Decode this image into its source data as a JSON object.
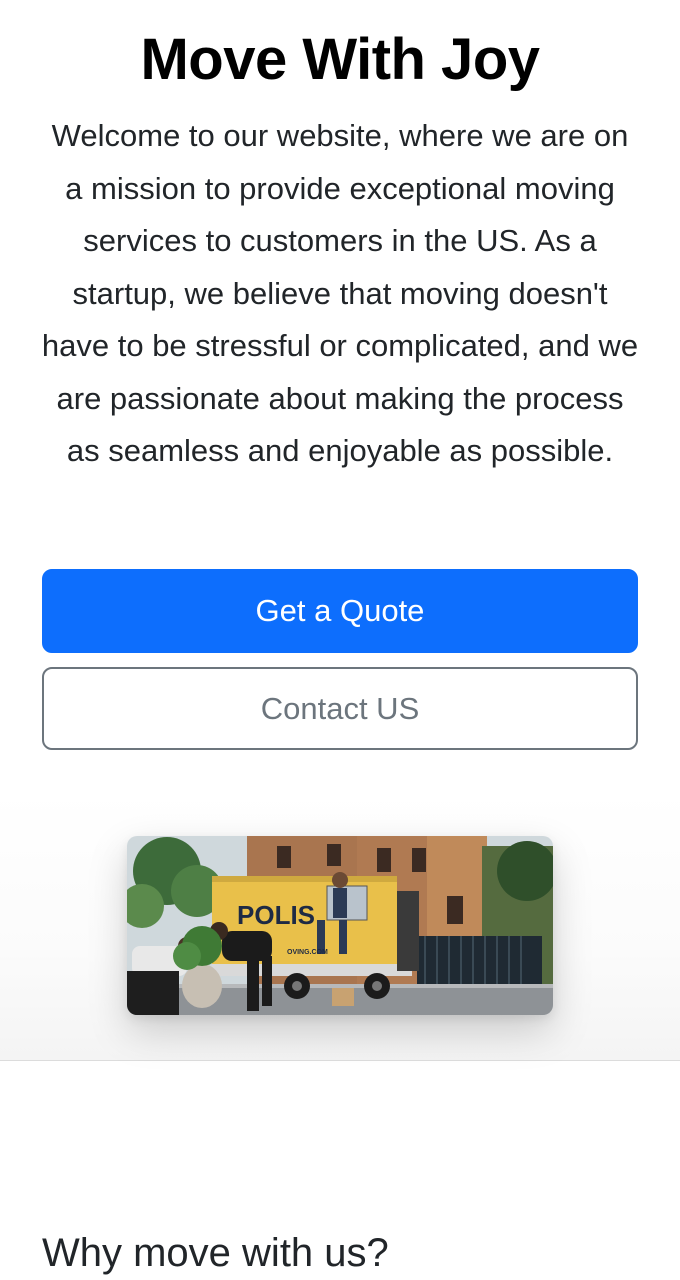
{
  "hero": {
    "title": "Move With Joy",
    "lead": "Welcome to our website, where we are on a mission to provide exceptional moving services to customers in the US. As a startup, we believe that moving doesn't have to be stressful or complicated, and we are passionate about making the process as seamless and enjoyable as possible.",
    "primary_button_label": "Get a Quote",
    "secondary_button_label": "Contact US"
  },
  "image": {
    "truck_text": "POLIS",
    "truck_small_text": "OVING.COM"
  },
  "why": {
    "heading": "Why move with us?"
  },
  "colors": {
    "primary": "#0d6efd",
    "secondary": "#6c757d",
    "truck_body": "#e9c04a"
  }
}
